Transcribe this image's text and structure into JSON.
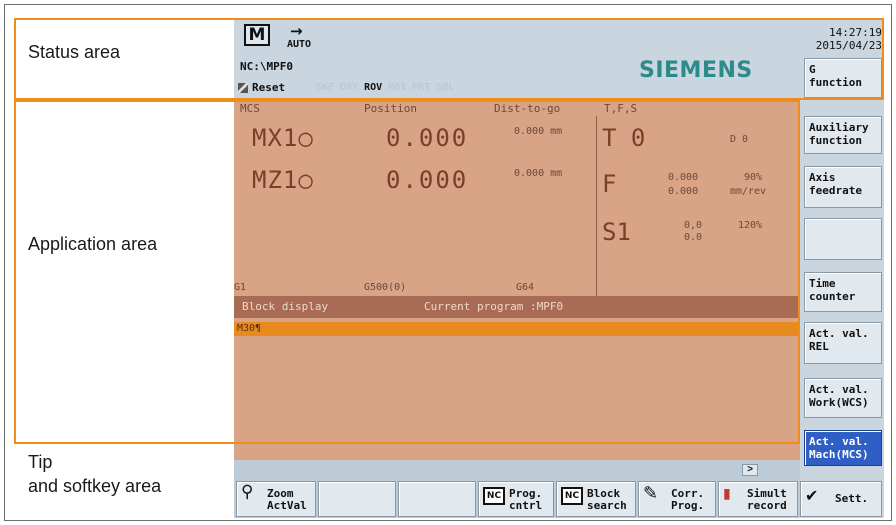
{
  "labels": {
    "status_area": "Status area",
    "application_area": "Application area",
    "tip_line1": "Tip",
    "tip_line2": "and softkey area"
  },
  "status": {
    "mode_icon": "M",
    "auto_label": "AUTO",
    "program_path": "NC:\\MPF0",
    "reset_label": "Reset",
    "flags": [
      "SKP",
      "DRY",
      "ROV",
      "M01",
      "PRT",
      "SBL"
    ],
    "active_flag": "ROV",
    "brand": "SIEMENS",
    "time": "14:27:19",
    "date": "2015/04/23"
  },
  "app": {
    "headers": {
      "mcs": "MCS",
      "position": "Position",
      "dist": "Dist-to-go",
      "tfs": "T,F,S"
    },
    "axes": [
      {
        "name": "MX1○",
        "position": "0.000",
        "dist": "0.000 mm"
      },
      {
        "name": "MZ1○",
        "position": "0.000",
        "dist": "0.000 mm"
      }
    ],
    "tool": {
      "label": "T 0",
      "d": "D  0"
    },
    "feed": {
      "label": "F",
      "v1": "0.000",
      "pct": "90%",
      "v2": "0.000",
      "unit": "mm/rev"
    },
    "spindle": {
      "label": "S1",
      "v1": "0,0",
      "v2": "0.0",
      "pct": "120%"
    },
    "gcodes": [
      "G1",
      "G500(0)",
      "G64"
    ],
    "block_display": "Block display",
    "current_program": "Current program :MPF0",
    "block_line": "M30¶"
  },
  "vkeys": [
    "G\nfunction",
    "Auxiliary\nfunction",
    "Axis\nfeedrate",
    "",
    "Time\ncounter",
    "Act. val.\nREL",
    "Act. val.\nWork(WCS)",
    "Act. val.\nMach(MCS)"
  ],
  "hkeys": {
    "zoom": "Zoom\nActVal",
    "prog_cntrl": "Prog.\ncntrl",
    "block_search": "Block\nsearch",
    "corr_prog": "Corr.\nProg.",
    "simult_record": "Simult\nrecord",
    "sett": "Sett.",
    "nc": "NC"
  },
  "tip_arrow": ">",
  "colors": {
    "accent": "#f08c1a",
    "app_bg": "#d9a386",
    "active_key": "#2f5fc4",
    "brand": "#2b8a8a"
  }
}
